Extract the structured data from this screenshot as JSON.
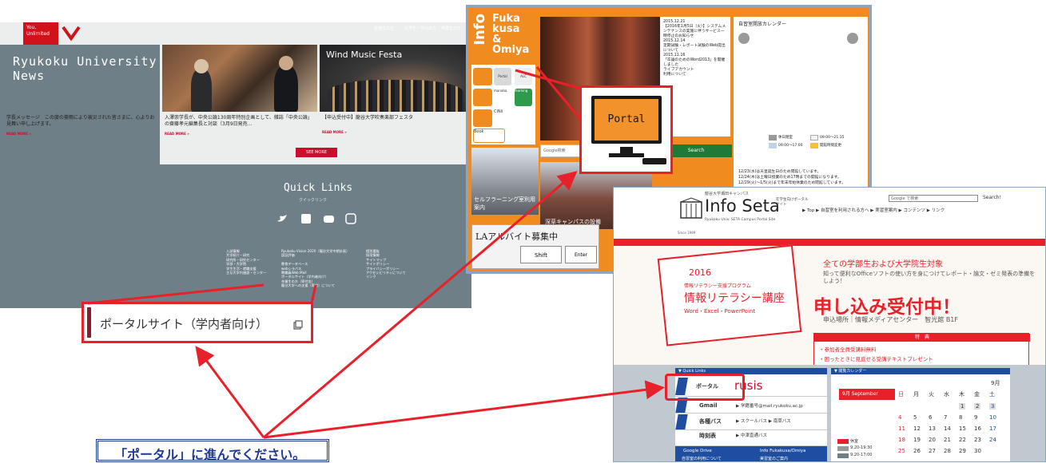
{
  "ryukoku": {
    "logo_text": "You,\nUnlimited",
    "logo_caption": "龍谷大学",
    "nav": [
      "受験生の方",
      "在学生・学内の方",
      "卒業生の方"
    ],
    "topics_label": "トピックス",
    "news_title_line1": "Ryukoku University",
    "news_title_line2": "News",
    "news_items": [
      {
        "text": "学長メッセージ　この度の豪雨により被災された皆さまに、心よりお見舞い申し上げます。",
        "readmore": "READ MORE »"
      },
      {
        "text": "入澤崇学長が、中央公論130周年特別企画として、雑誌「中央公論」の齋藤孝元編集長と対談（3月9日発売…",
        "readmore": "READ MORE »"
      },
      {
        "text": "【申込受付中】龍谷大学吹奏楽部フェスタ",
        "readmore": "READ MORE »"
      }
    ],
    "wind_title": "Wind Music Festa",
    "see_more": "SEE MORE",
    "quick_links_title": "Quick Links",
    "quick_links_sub": "クイックリンク",
    "col1": [
      "入試情報",
      "大学紹介・研究",
      "研究所・研究センター",
      "学部・大学院",
      "学生生活・就職支援",
      "主な大学内施設・センター"
    ],
    "col2": [
      "Ryukoku Vision 2020（龍谷大学中期計画）",
      "認証評価",
      "",
      "教育データベース",
      "webシラバス",
      "教職員Web Mail",
      "ポータルサイト（学内者向け）",
      "卒業生の方（寄付金）",
      "龍谷大学への支援（寄付）について"
    ],
    "col3": [
      "個別選抜",
      "採用情報",
      "サイトマップ",
      "サイトポリシー",
      "プライバシーポリシー",
      "アクセシビリティについて",
      "リンク"
    ]
  },
  "callout": {
    "text": "ポータルサイト（学内者向け）"
  },
  "banner": {
    "text": "「ポータル」に進んでください。"
  },
  "info": {
    "vertical": "Info",
    "fukakusa": [
      "Fuka",
      "kusa",
      "&",
      "Omiya"
    ],
    "tiles": [
      "Portal",
      "ALC",
      "manaba",
      "learning",
      "CiNii",
      "Book"
    ],
    "news_lines": [
      "2015.12.21",
      "【2016年1月5日（火）】システムメンテナンスの実施に伴うサービス一時停止のお知らせ",
      "2015.12.14",
      "定期試験・レポート試験のWeb提出について",
      "2015.11.16",
      "「卒論のためのWord2013」を開催しました",
      "ライブアカウント",
      "利用について"
    ],
    "calendar_title": "自習室開放カレンダー",
    "legend": [
      "休日閉室",
      "09:00〜21:35",
      "09:00〜17:00",
      "開館時間変更"
    ],
    "google_placeholder": "Google検索",
    "search_btn": "Search",
    "notices": [
      "12/23(水)は天皇誕生日のため閉館しています。",
      "12/24(木)は土曜日授業のため17時までの開館になります。",
      "12/29(火)〜1/5(火)まで年末年始休業のため閉館しています。"
    ],
    "building_caption": "セルフラーニング室利用案内",
    "building2_caption": "深草キャンパスの設備",
    "la_text": "LAアルバイト募集中",
    "shift_label": "Shift",
    "enter_label": "Enter",
    "portal_icon_label": "Portal"
  },
  "seta": {
    "univ": "龍谷大学瀬田キャンパス",
    "title": "Info Seta",
    "subtitle": "在学生向けポータルサイト",
    "eng": "Ryukoku Univ. SETA Campus Portal Site",
    "since": "Since 1989",
    "search_placeholder": "Google で検索",
    "search_btn": "Search!",
    "nav": [
      "▶ Top",
      "▶ 自習室を利用される方へ",
      "▶ 実習室案内",
      "▶ コンテンツ",
      "▶ リンク"
    ],
    "year": "2016",
    "program": "情報リテラシー支援プログラム",
    "course": "情報リテラシー講座",
    "software": "Word・Excel・PowerPoint",
    "target": "全ての学部生および大学院生対象",
    "desc": "知って便利なOfficeソフトの使い方を身につけてレポート・論文・ゼミ発表の準備をしよう！",
    "apply": "申し込み受付中！",
    "place": "申込場所｜情報メディアセンター　智光館 B1F",
    "perk_title": "特　典",
    "perks": [
      "・参加者全員受講料無料",
      "・困ったときに見直せる受講テキストプレゼント"
    ],
    "ql_head": "▼ Quick Links",
    "ql_rows": [
      "ポータル",
      "Gmail",
      "各種バス",
      "時刻表",
      "Google Drive",
      "自習室の利用について"
    ],
    "ql_right": [
      "rusis",
      "▶ 学籍番号@mail.ryukoku.ac.jp",
      "▶ スクールバス ▶ 南草バス",
      "▶ 中津直通バス",
      "Info Fukakusa/Omiya",
      "実習室のご案内"
    ],
    "cal_head": "▼ 閲覧カレンダー",
    "cal_month": "9月",
    "cal_month_label": "9月 September",
    "weekdays": [
      "日",
      "月",
      "火",
      "水",
      "木",
      "金",
      "土"
    ],
    "days": [
      [
        "",
        "",
        "",
        "",
        "1",
        "2",
        "3"
      ],
      [
        "4",
        "5",
        "6",
        "7",
        "8",
        "9",
        "10"
      ],
      [
        "11",
        "12",
        "13",
        "14",
        "15",
        "16",
        "17"
      ],
      [
        "18",
        "19",
        "20",
        "21",
        "22",
        "23",
        "24"
      ],
      [
        "25",
        "26",
        "27",
        "28",
        "29",
        "30",
        ""
      ]
    ],
    "legend": [
      "休室",
      "9:20-19:30",
      "9:20-17:00"
    ]
  },
  "colors": {
    "accent_red": "#e8202a",
    "orange": "#f08b1f",
    "navy": "#1f4ea1",
    "slate": "#6e7f87"
  }
}
